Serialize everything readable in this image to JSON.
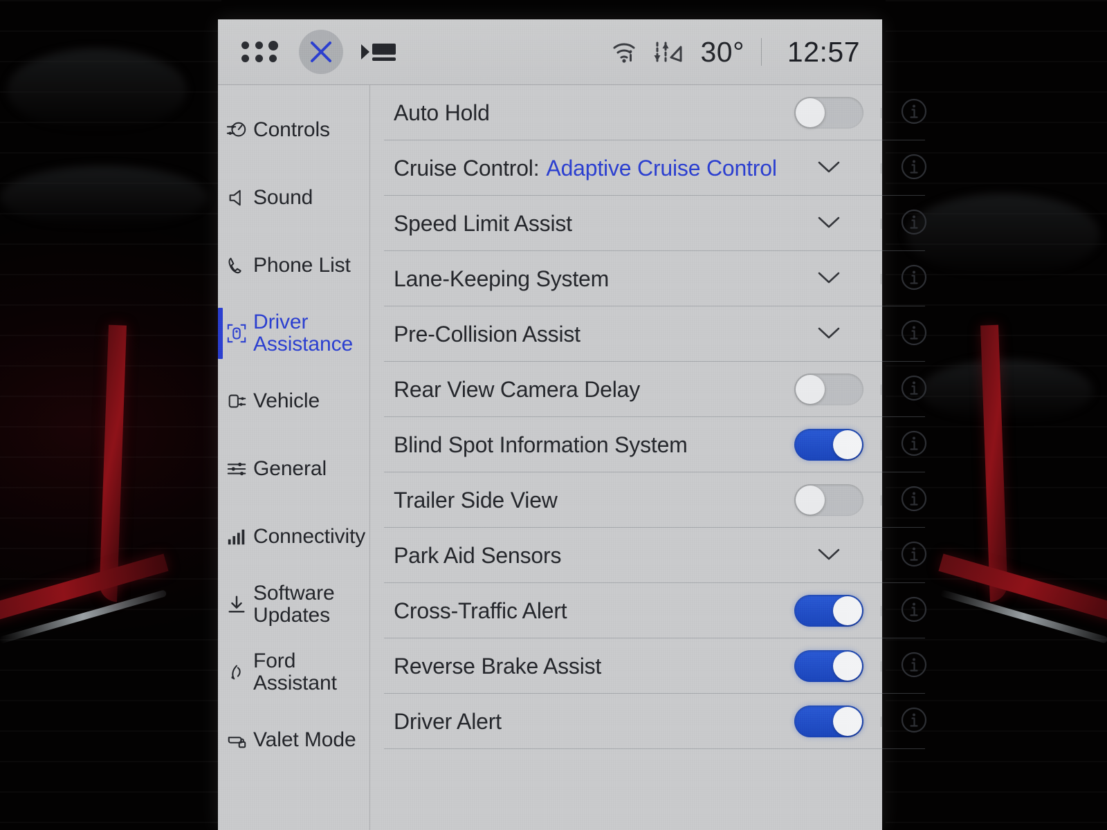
{
  "statusbar": {
    "apps_icon": "apps-grid-icon",
    "close_icon": "close-x-icon",
    "media_icon": "media-display-icon",
    "wifi_icon": "wifi-icon",
    "data_transfer_icon": "data-transfer-icon",
    "temperature": "30°",
    "clock": "12:57"
  },
  "sidebar": {
    "items": [
      {
        "label": "Controls",
        "icon": "controls-icon",
        "active": false,
        "two_line": false
      },
      {
        "label": "Sound",
        "icon": "speaker-icon",
        "active": false,
        "two_line": false
      },
      {
        "label": "Phone List",
        "icon": "phone-icon",
        "active": false,
        "two_line": false
      },
      {
        "label": "Driver Assistance",
        "icon": "driver-assistance-icon",
        "active": true,
        "two_line": true
      },
      {
        "label": "Vehicle",
        "icon": "vehicle-icon",
        "active": false,
        "two_line": false
      },
      {
        "label": "General",
        "icon": "sliders-icon",
        "active": false,
        "two_line": false
      },
      {
        "label": "Connectivity",
        "icon": "signal-bars-icon",
        "active": false,
        "two_line": false
      },
      {
        "label": "Software Updates",
        "icon": "download-icon",
        "active": true,
        "two_line": true
      },
      {
        "label": "Ford Assistant",
        "icon": "assistant-icon",
        "active": false,
        "two_line": true
      },
      {
        "label": "Valet Mode",
        "icon": "valet-lock-icon",
        "active": false,
        "two_line": false
      }
    ]
  },
  "settings": {
    "rows": [
      {
        "label": "Auto Hold",
        "control": "toggle",
        "value": "",
        "on": false,
        "info": true
      },
      {
        "label": "Cruise Control:",
        "control": "chevron",
        "value": "Adaptive Cruise Control",
        "on": false,
        "info": true
      },
      {
        "label": "Speed Limit Assist",
        "control": "chevron",
        "value": "",
        "on": false,
        "info": true
      },
      {
        "label": "Lane-Keeping System",
        "control": "chevron",
        "value": "",
        "on": false,
        "info": true
      },
      {
        "label": "Pre-Collision Assist",
        "control": "chevron",
        "value": "",
        "on": false,
        "info": true
      },
      {
        "label": "Rear View Camera Delay",
        "control": "toggle",
        "value": "",
        "on": false,
        "info": true
      },
      {
        "label": "Blind Spot Information System",
        "control": "toggle",
        "value": "",
        "on": true,
        "info": true
      },
      {
        "label": "Trailer Side View",
        "control": "toggle",
        "value": "",
        "on": false,
        "info": true
      },
      {
        "label": "Park Aid Sensors",
        "control": "chevron",
        "value": "",
        "on": false,
        "info": true
      },
      {
        "label": "Cross-Traffic Alert",
        "control": "toggle",
        "value": "",
        "on": true,
        "info": true
      },
      {
        "label": "Reverse Brake Assist",
        "control": "toggle",
        "value": "",
        "on": true,
        "info": true
      },
      {
        "label": "Driver Alert",
        "control": "toggle",
        "value": "",
        "on": true,
        "info": true
      }
    ]
  },
  "colors": {
    "accent_blue": "#2b3fd0",
    "toggle_on": "#1b45bb",
    "screen_bg": "#c9cacc",
    "text": "#24262b"
  }
}
